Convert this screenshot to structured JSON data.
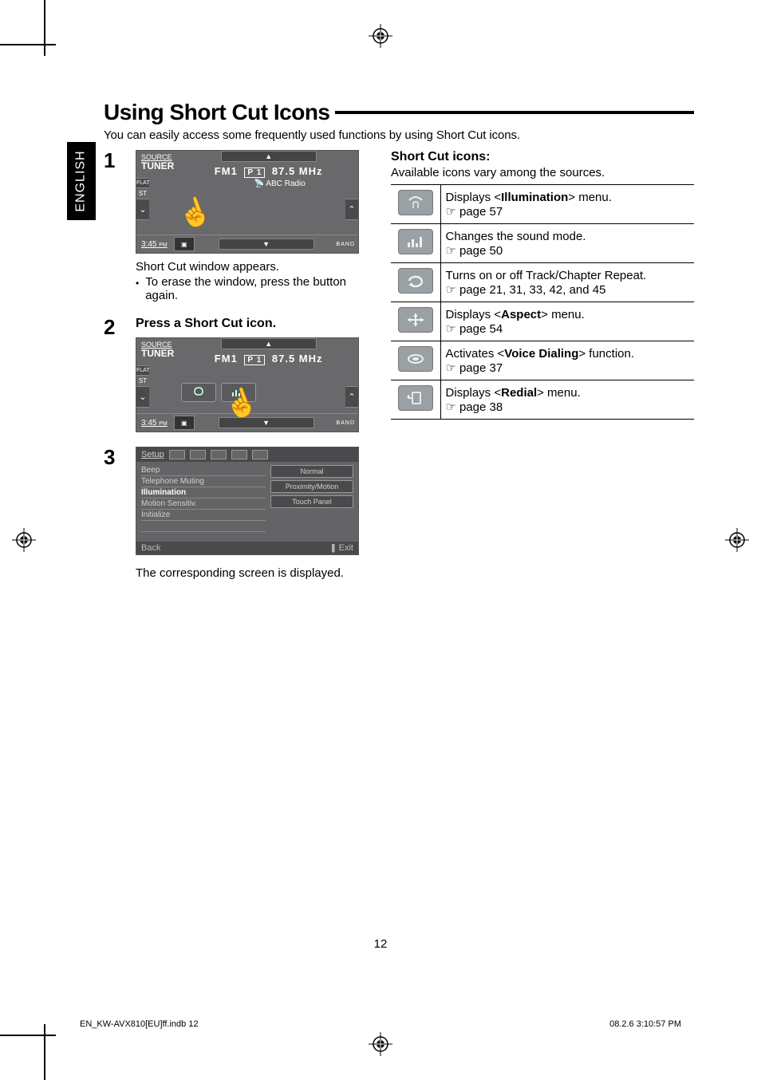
{
  "language_tab": "ENGLISH",
  "title": "Using Short Cut Icons",
  "intro": "You can easily access some frequently used functions by using Short Cut icons.",
  "steps": {
    "s1": {
      "num": "1",
      "screenshot": {
        "source_top": "SOURCE",
        "source_main": "TUNER",
        "band": "FM1",
        "preset": "P 1",
        "freq": "87.5 MHz",
        "station": "ABC Radio",
        "flat": "FLAT",
        "st": "ST",
        "time": "3:45",
        "time_pm": "PM",
        "band_label": "BAND"
      },
      "caption": "Short Cut window appears.",
      "bullet": "To erase the window, press the button again."
    },
    "s2": {
      "num": "2",
      "title": "Press a Short Cut icon.",
      "screenshot": {
        "source_top": "SOURCE",
        "source_main": "TUNER",
        "band": "FM1",
        "preset": "P 1",
        "freq": "87.5 MHz",
        "flat": "FLAT",
        "st": "ST",
        "time": "3:45",
        "time_pm": "PM",
        "band_label": "BAND"
      }
    },
    "s3": {
      "num": "3",
      "setup": {
        "title": "Setup",
        "left": {
          "i0": "Beep",
          "i1": "Telephone Muting",
          "i2": "Illumination",
          "i3": "Motion Sensitiv.",
          "i4": "Initialize"
        },
        "right": {
          "i0": "Normal",
          "i1": "Proximity/Motion",
          "i2": "Touch Panel"
        },
        "back": "Back",
        "exit": "Exit"
      },
      "caption": "The corresponding screen is displayed."
    }
  },
  "shortcut": {
    "heading": "Short Cut icons:",
    "sub": "Available icons vary among the sources.",
    "rows": {
      "r0": {
        "text_pre": "Displays <",
        "bold": "Illumination",
        "text_post": "> menu.",
        "page": "page 57"
      },
      "r1": {
        "text": "Changes the sound mode.",
        "page": "page 50"
      },
      "r2": {
        "text": "Turns on or off Track/Chapter Repeat.",
        "page": "page 21, 31, 33, 42, and 45"
      },
      "r3": {
        "text_pre": "Displays <",
        "bold": "Aspect",
        "text_post": "> menu.",
        "page": "page 54"
      },
      "r4": {
        "text_pre": "Activates <",
        "bold": "Voice Dialing",
        "text_post": "> function.",
        "page": "page 37"
      },
      "r5": {
        "text_pre": "Displays <",
        "bold": "Redial",
        "text_post": "> menu.",
        "page": "page 38"
      }
    }
  },
  "page_number": "12",
  "footer_left": "EN_KW-AVX810[EU]ff.indb   12",
  "footer_right": "08.2.6   3:10:57 PM"
}
